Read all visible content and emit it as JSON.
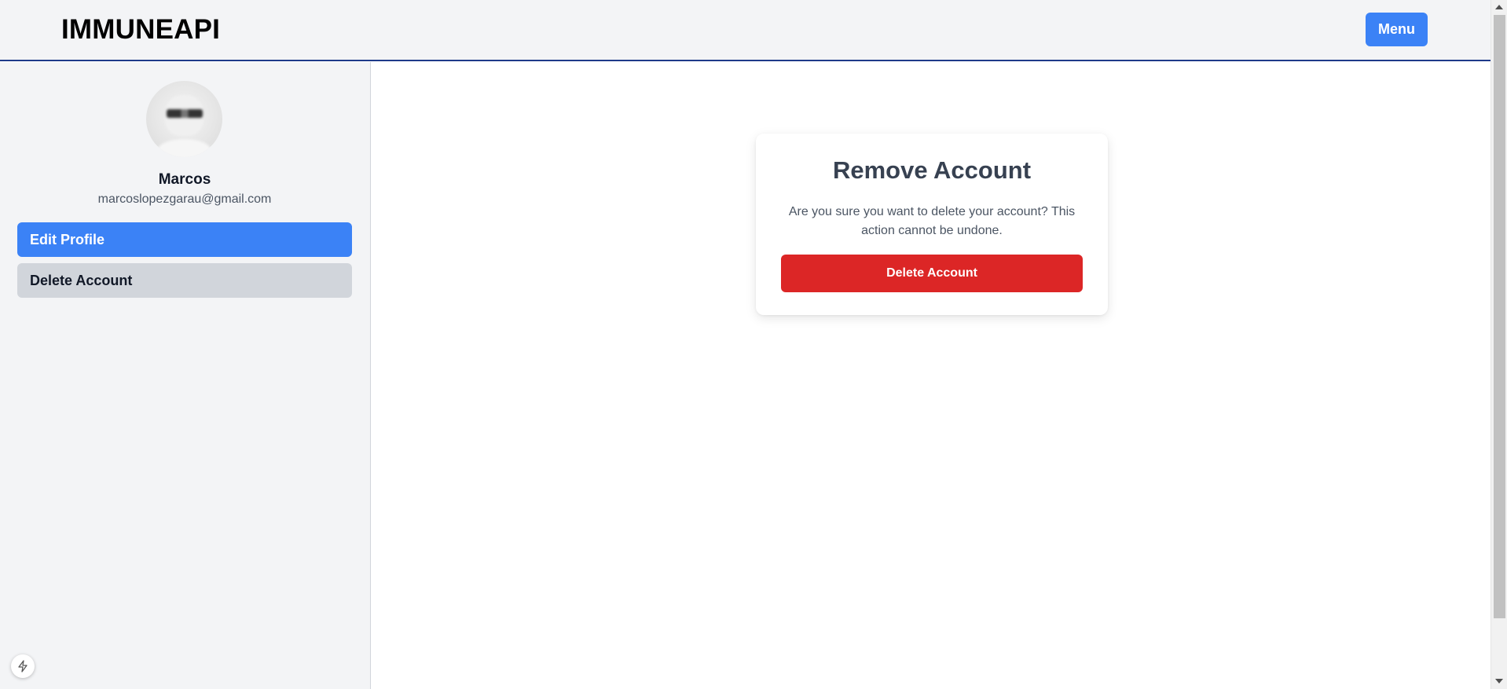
{
  "header": {
    "brand": "IMMUNEAPI",
    "menu_label": "Menu",
    "accent_color": "#3b82f6"
  },
  "sidebar": {
    "avatar_icon": "user-avatar",
    "user_name": "Marcos",
    "user_email": "marcoslopezgarau@gmail.com",
    "items": [
      {
        "label": "Edit Profile",
        "active": true
      },
      {
        "label": "Delete Account",
        "active": false
      }
    ],
    "badge_icon": "bolt-icon"
  },
  "main": {
    "card": {
      "title": "Remove Account",
      "message": "Are you sure you want to delete your account? This action cannot be undone.",
      "button_label": "Delete Account",
      "button_color": "#dc2626"
    }
  }
}
